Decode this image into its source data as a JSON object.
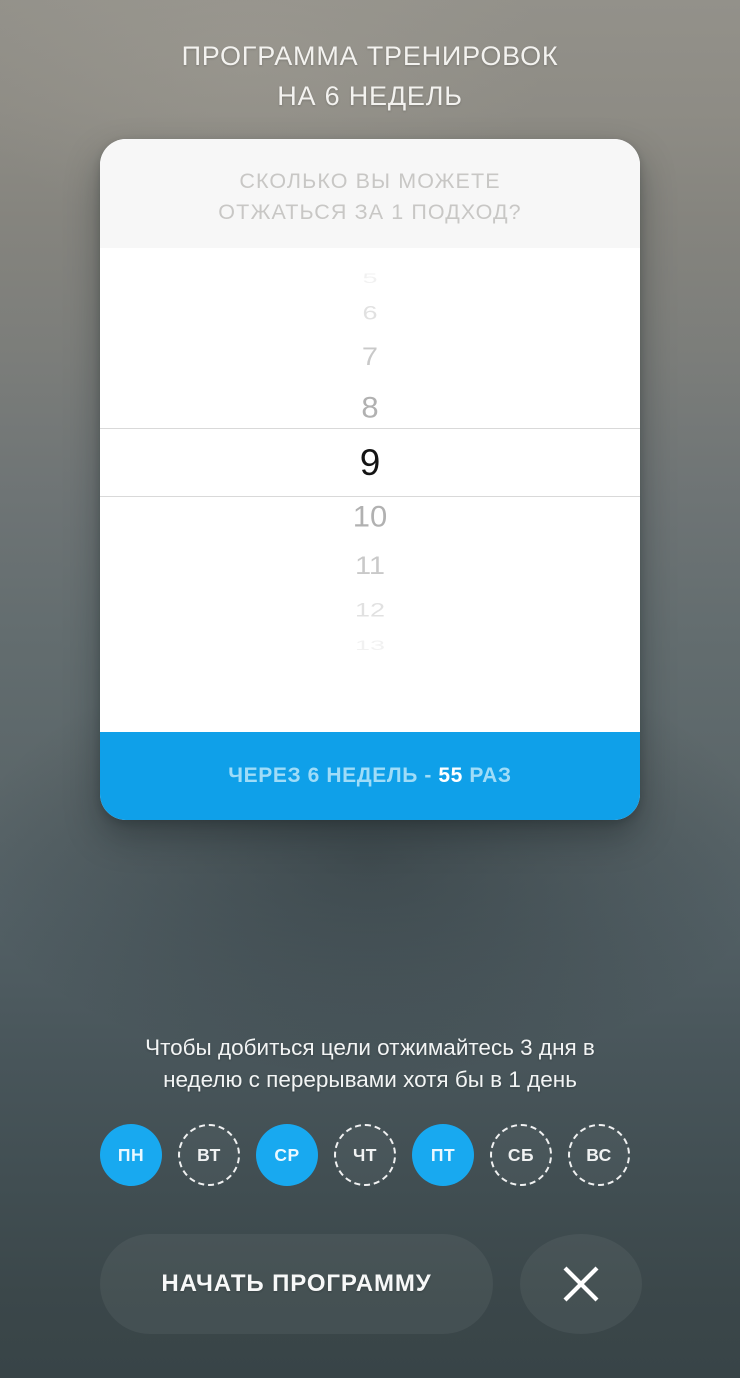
{
  "header": {
    "title_lines": [
      "ПРОГРАММА ТРЕНИРОВОК",
      "НА 6 НЕДЕЛЬ"
    ],
    "title_full": "ПРОГРАММА ТРЕНИРОВОК НА 6 НЕДЕЛЬ"
  },
  "card": {
    "question_lines": [
      "СКОЛЬКО ВЫ МОЖЕТЕ",
      "ОТЖАТЬСЯ ЗА 1 ПОДХОД?"
    ],
    "question_full": "СКОЛЬКО ВЫ МОЖЕТЕ ОТЖАТЬСЯ ЗА 1 ПОДХОД?",
    "picker": {
      "options": [
        "5",
        "6",
        "7",
        "8",
        "9",
        "10",
        "11",
        "12",
        "13"
      ],
      "selected_value": "9",
      "selected_index": 4
    },
    "result": {
      "prefix": "ЧЕРЕЗ 6 НЕДЕЛЬ -",
      "value": "55",
      "suffix": "РАЗ",
      "full": "ЧЕРЕЗ 6 НЕДЕЛЬ - 55 РАЗ"
    }
  },
  "instruction": {
    "lines": [
      "Чтобы добиться цели отжимайтесь 3 дня в",
      "неделю с перерывами хотя бы в 1 день"
    ],
    "full": "Чтобы добиться цели отжимайтесь 3 дня в неделю с перерывами хотя бы в 1 день"
  },
  "days": [
    {
      "label": "ПН",
      "active": true
    },
    {
      "label": "ВТ",
      "active": false
    },
    {
      "label": "СР",
      "active": true
    },
    {
      "label": "ЧТ",
      "active": false
    },
    {
      "label": "ПТ",
      "active": true
    },
    {
      "label": "СБ",
      "active": false
    },
    {
      "label": "ВС",
      "active": false
    }
  ],
  "actions": {
    "start_label": "НАЧАТЬ ПРОГРАММУ",
    "close_icon": "close-icon"
  },
  "colors": {
    "accent_blue": "#18a9f0",
    "footer_blue": "#0fa0e9",
    "footer_text": "#9fdcf8",
    "card_bg": "#ffffff",
    "card_header_bg": "#f7f7f7",
    "picker_inactive_text": "#9a9a9a",
    "picker_active_text": "#141414",
    "bg_top": "#93918a",
    "bg_bottom": "#384447"
  }
}
